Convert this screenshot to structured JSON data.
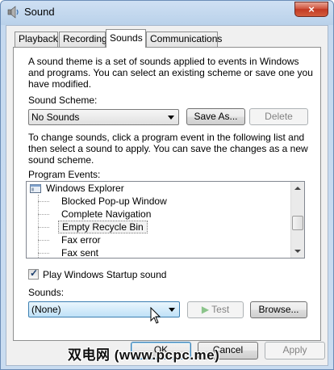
{
  "window": {
    "title": "Sound",
    "close_glyph": "×"
  },
  "tabs": [
    "Playback",
    "Recording",
    "Sounds",
    "Communications"
  ],
  "active_tab": "Sounds",
  "intro_text": [
    "A sound theme is a set of sounds applied to events in Windows",
    "and programs.  You can select an existing scheme or save one you",
    "have modified."
  ],
  "scheme": {
    "label": "Sound Scheme:",
    "value": "No Sounds",
    "save_as": "Save As...",
    "delete": "Delete"
  },
  "change_text": [
    "To change sounds, click a program event in the following list and",
    "then select a sound to apply.  You can save the changes as a new",
    "sound scheme."
  ],
  "events": {
    "label": "Program Events:",
    "group": "Windows Explorer",
    "items": [
      "Blocked Pop-up Window",
      "Complete Navigation",
      "Empty Recycle Bin",
      "Fax error",
      "Fax sent"
    ],
    "selected": "Empty Recycle Bin"
  },
  "startup_sound": {
    "label": "Play Windows Startup sound",
    "checked": true,
    "check_glyph": "✓"
  },
  "sounds": {
    "label": "Sounds:",
    "value": "(None)",
    "test": "Test",
    "test_glyph": "▶",
    "browse": "Browse..."
  },
  "footer": {
    "ok": "OK",
    "cancel": "Cancel",
    "apply": "Apply"
  },
  "watermark": "双电网 (www.pcpc.me)",
  "icons": {
    "title": "speaker-icon",
    "group": "windows-explorer-icon",
    "cursor": "mouse-pointer-icon"
  }
}
